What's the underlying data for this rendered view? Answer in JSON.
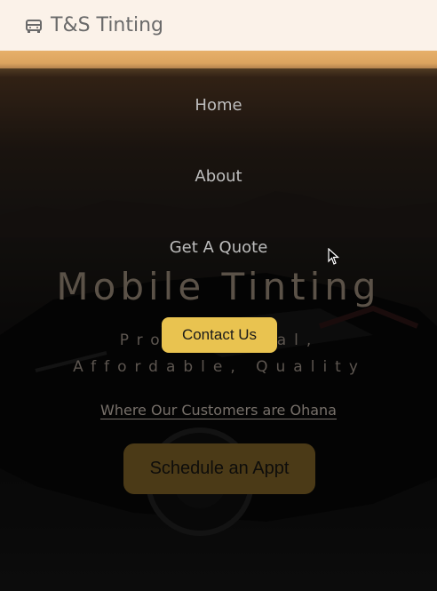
{
  "brand": {
    "name": "T&S Tinting",
    "icon": "car-icon"
  },
  "nav": {
    "items": [
      {
        "label": "Home"
      },
      {
        "label": "About"
      },
      {
        "label": "Get A Quote"
      }
    ],
    "contact_label": "Contact Us"
  },
  "hero": {
    "title": "Mobile Tinting",
    "subtitle": "Professional, Affordable, Quality",
    "tagline": "Where Our Customers are Ohana",
    "cta_label": "Schedule an Appt"
  },
  "colors": {
    "header_bg": "#fbf2e9",
    "accent": "#e9c350",
    "cta_bg": "#4b3a17"
  }
}
